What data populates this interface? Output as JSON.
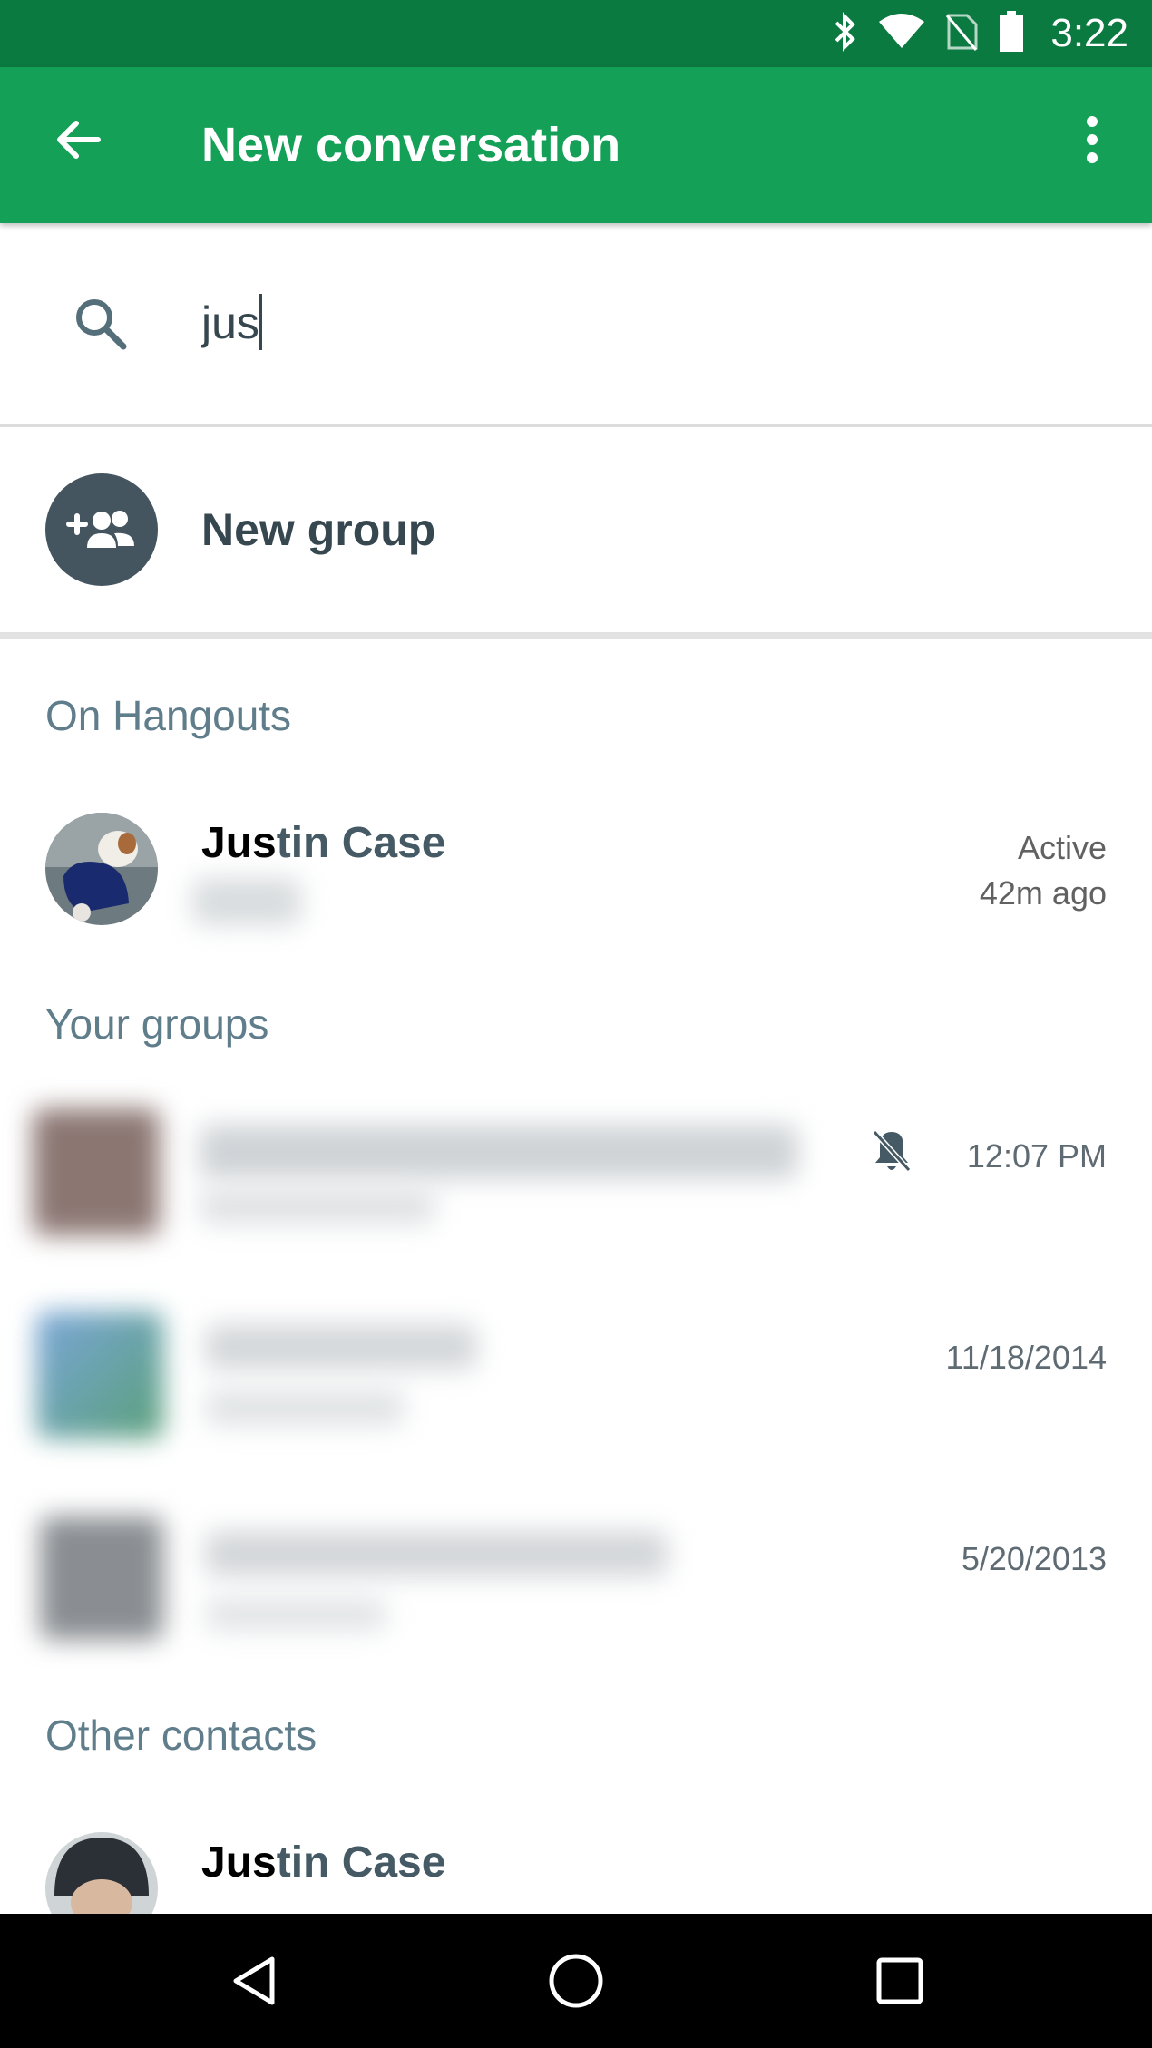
{
  "status_bar": {
    "time": "3:22",
    "icons": [
      "bluetooth-icon",
      "wifi-icon",
      "no-sim-icon",
      "battery-icon"
    ]
  },
  "app_bar": {
    "title": "New conversation",
    "back_icon": "arrow-back-icon",
    "more_icon": "more-vert-icon",
    "color": "#15a058"
  },
  "search": {
    "value": "jus",
    "icon": "search-icon"
  },
  "new_group": {
    "label": "New group",
    "icon": "group-add-icon"
  },
  "sections": {
    "on_hangouts": "On Hangouts",
    "your_groups": "Your groups",
    "other_contacts": "Other contacts"
  },
  "on_hangouts": [
    {
      "name_match": "Jus",
      "name_rest": "tin Case",
      "status_line1": "Active",
      "status_line2": "42m ago"
    }
  ],
  "your_groups": [
    {
      "time": "12:07 PM",
      "muted": true
    },
    {
      "time": "11/18/2014",
      "muted": false
    },
    {
      "time": "5/20/2013",
      "muted": false
    }
  ],
  "other_contacts": [
    {
      "name_match": "Jus",
      "name_rest": "tin Case"
    }
  ],
  "nav_bar": {
    "buttons": [
      "back-triangle-icon",
      "home-circle-icon",
      "recents-square-icon"
    ]
  }
}
